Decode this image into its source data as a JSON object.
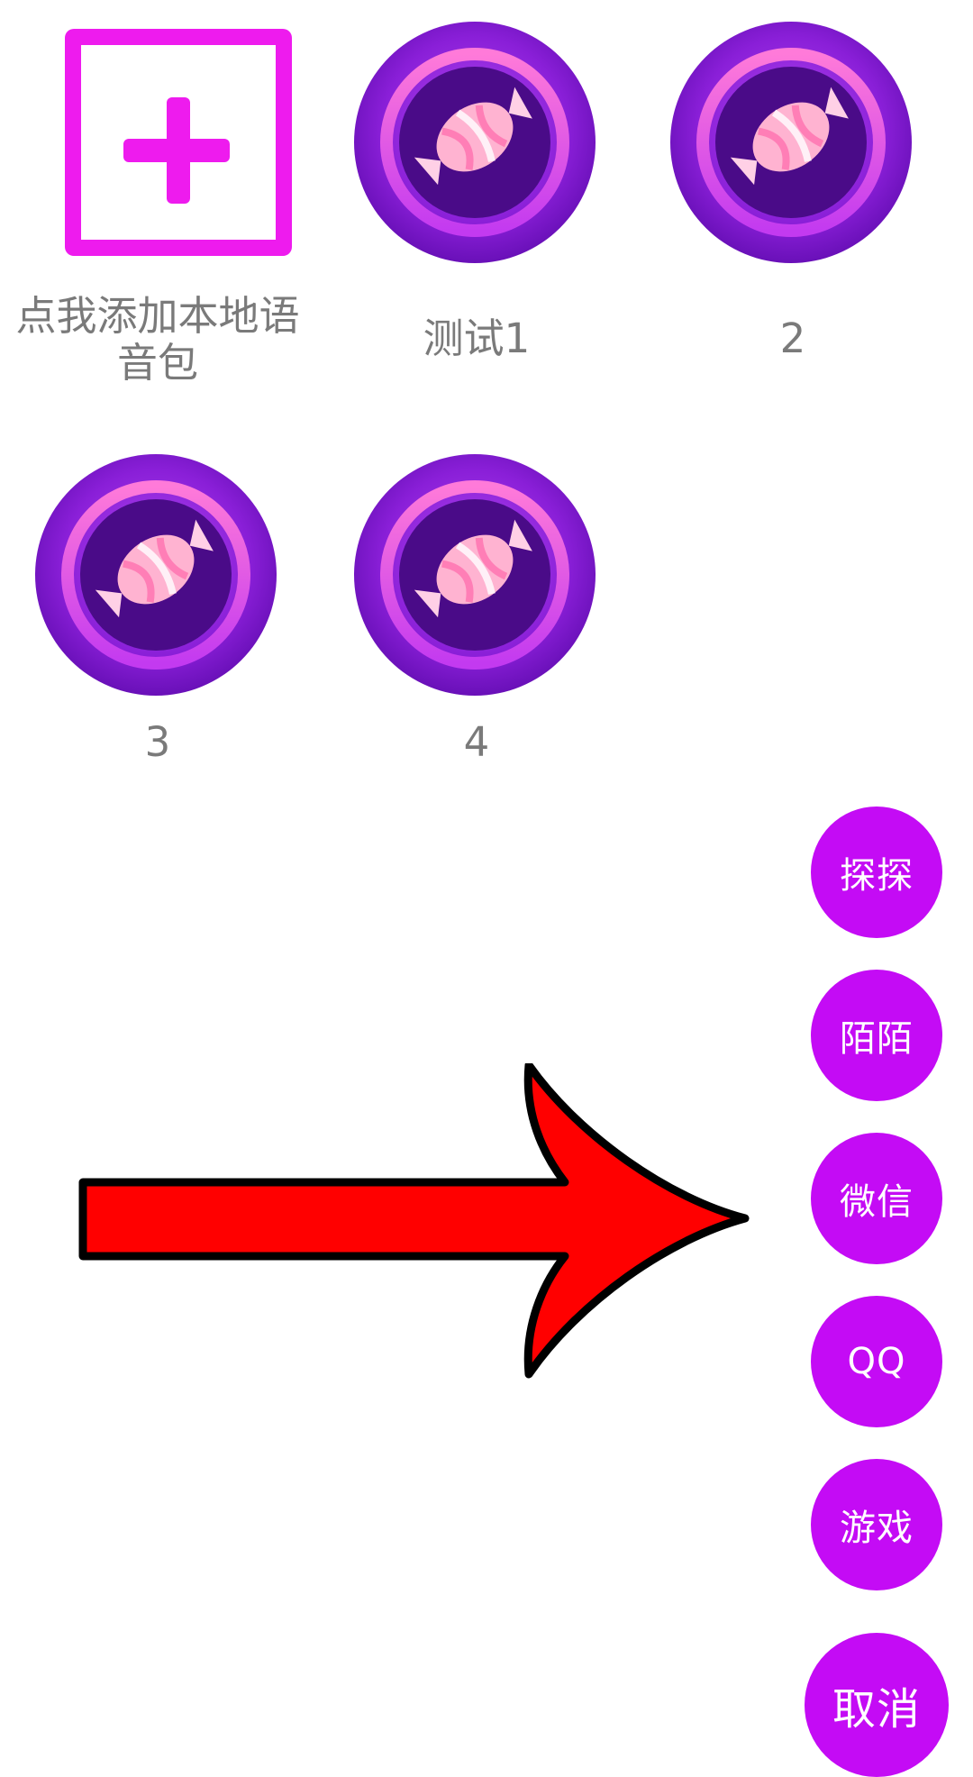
{
  "voice_pack_grid": {
    "add_local": {
      "label": "点我添加本地语音包"
    },
    "packs": [
      {
        "label": "测试1"
      },
      {
        "label": "2"
      },
      {
        "label": "3"
      },
      {
        "label": "4"
      }
    ]
  },
  "floating_menu": {
    "items": [
      {
        "label": "探探"
      },
      {
        "label": "陌陌"
      },
      {
        "label": "微信"
      },
      {
        "label": "QQ"
      },
      {
        "label": "游戏"
      }
    ],
    "cancel_label": "取消"
  },
  "colors": {
    "accent_magenta": "#ee1bee",
    "menu_purple": "#c40bf5",
    "arrow_red": "#ff0000"
  },
  "icons": {
    "add": "plus-square-icon",
    "pack": "candy-disc-icon",
    "pointer": "red-arrow-right"
  }
}
